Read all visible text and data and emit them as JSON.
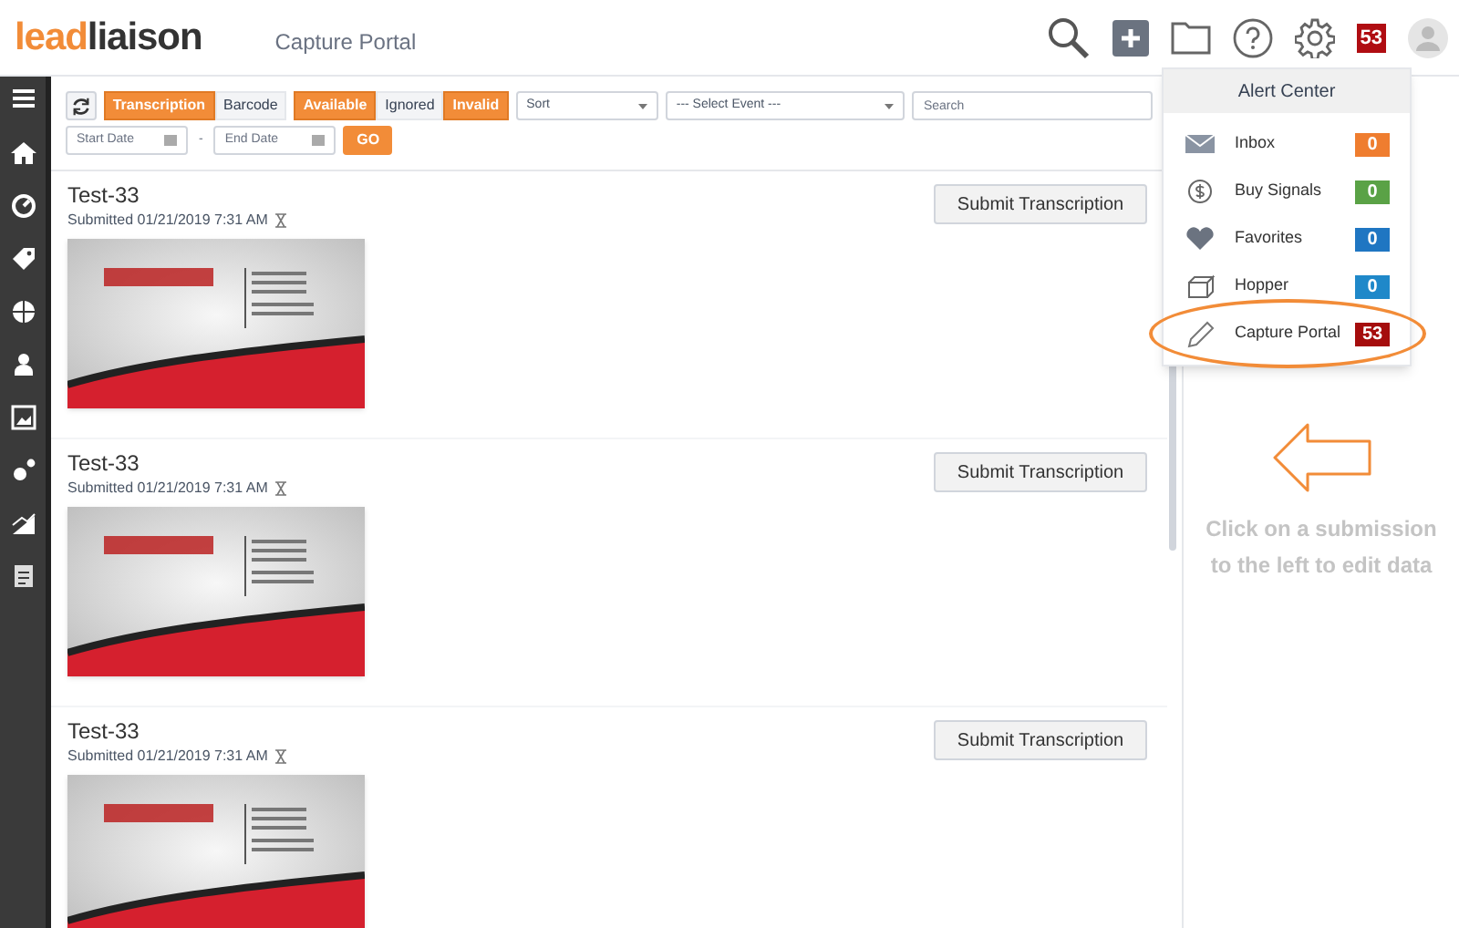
{
  "header": {
    "logo_lead": "lead",
    "logo_rest": "liaison",
    "section": "Capture Portal",
    "notification_count": "53"
  },
  "filters": {
    "type_toggles": [
      {
        "label": "Transcription",
        "selected": true
      },
      {
        "label": "Barcode",
        "selected": false
      }
    ],
    "status_toggles": [
      {
        "label": "Available",
        "selected": true
      },
      {
        "label": "Ignored",
        "selected": false
      },
      {
        "label": "Invalid",
        "selected": true
      }
    ],
    "sort": "Sort",
    "event": "--- Select Event ---",
    "search_placeholder": "Search",
    "start_placeholder": "Start Date",
    "separator": "-",
    "end_placeholder": "End Date",
    "go": "GO"
  },
  "submissions": [
    {
      "title": "Test-33",
      "submitted": "Submitted 01/21/2019 7:31 AM",
      "button": "Submit Transcription"
    },
    {
      "title": "Test-33",
      "submitted": "Submitted 01/21/2019 7:31 AM",
      "button": "Submit Transcription"
    },
    {
      "title": "Test-33",
      "submitted": "Submitted 01/21/2019 7:31 AM",
      "button": "Submit Transcription"
    }
  ],
  "alert_center": {
    "title": "Alert Center",
    "items": [
      {
        "label": "Inbox",
        "count": "0",
        "color": "#ef7d2f",
        "highlighted": false
      },
      {
        "label": "Buy Signals",
        "count": "0",
        "color": "#5aa246",
        "highlighted": false
      },
      {
        "label": "Favorites",
        "count": "0",
        "color": "#1f76c2",
        "highlighted": false
      },
      {
        "label": "Hopper",
        "count": "0",
        "color": "#1f88c9",
        "highlighted": false
      },
      {
        "label": "Capture Portal",
        "count": "53",
        "color": "#a50d0d",
        "highlighted": true
      }
    ]
  },
  "hint": "Click on a submission to the left to edit data"
}
